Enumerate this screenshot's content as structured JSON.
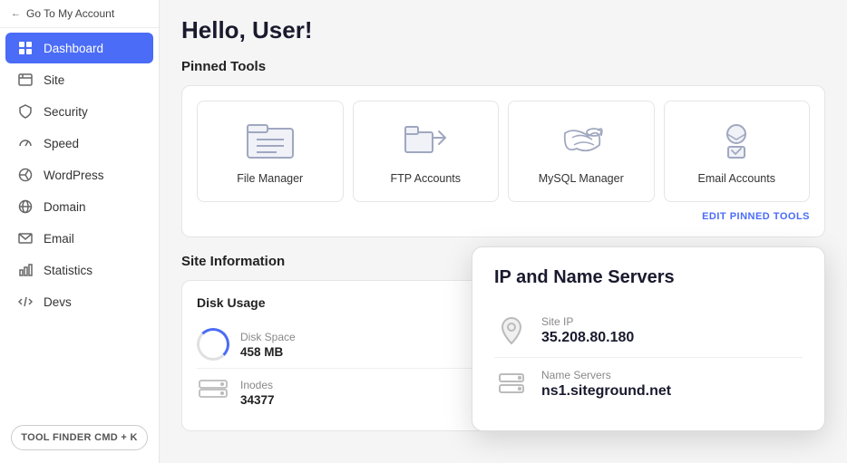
{
  "sidebar": {
    "go_to_account": "Go To My Account",
    "items": [
      {
        "id": "dashboard",
        "label": "Dashboard",
        "icon": "⊞",
        "active": true
      },
      {
        "id": "site",
        "label": "Site",
        "icon": "◫"
      },
      {
        "id": "security",
        "label": "Security",
        "icon": "🔒"
      },
      {
        "id": "speed",
        "label": "Speed",
        "icon": "⚡"
      },
      {
        "id": "wordpress",
        "label": "WordPress",
        "icon": "Ⓦ"
      },
      {
        "id": "domain",
        "label": "Domain",
        "icon": "🌐"
      },
      {
        "id": "email",
        "label": "Email",
        "icon": "✉"
      },
      {
        "id": "statistics",
        "label": "Statistics",
        "icon": "📊"
      },
      {
        "id": "devs",
        "label": "Devs",
        "icon": "⌨"
      }
    ],
    "tool_finder": "TOOL FINDER CMD + K"
  },
  "main": {
    "greeting": "Hello, User!",
    "pinned_tools": {
      "section_title": "Pinned Tools",
      "tools": [
        {
          "id": "file-manager",
          "label": "File Manager"
        },
        {
          "id": "ftp-accounts",
          "label": "FTP Accounts"
        },
        {
          "id": "mysql-manager",
          "label": "MySQL Manager"
        },
        {
          "id": "email-accounts",
          "label": "Email Accounts"
        }
      ],
      "edit_label": "EDIT PINNED TOOLS"
    },
    "site_info": {
      "section_title": "Site Information",
      "disk_usage": {
        "title": "Disk Usage",
        "items": [
          {
            "label": "Disk Space",
            "value": "458 MB"
          },
          {
            "label": "Inodes",
            "value": "34377"
          }
        ]
      },
      "ip_servers": {
        "title": "IP and Name Servers",
        "site_ip_label": "Site IP",
        "site_ip_value": "35.208.80.180",
        "name_servers_label": "Name Servers",
        "name_servers_value": "ns1.siteground.net"
      }
    }
  }
}
